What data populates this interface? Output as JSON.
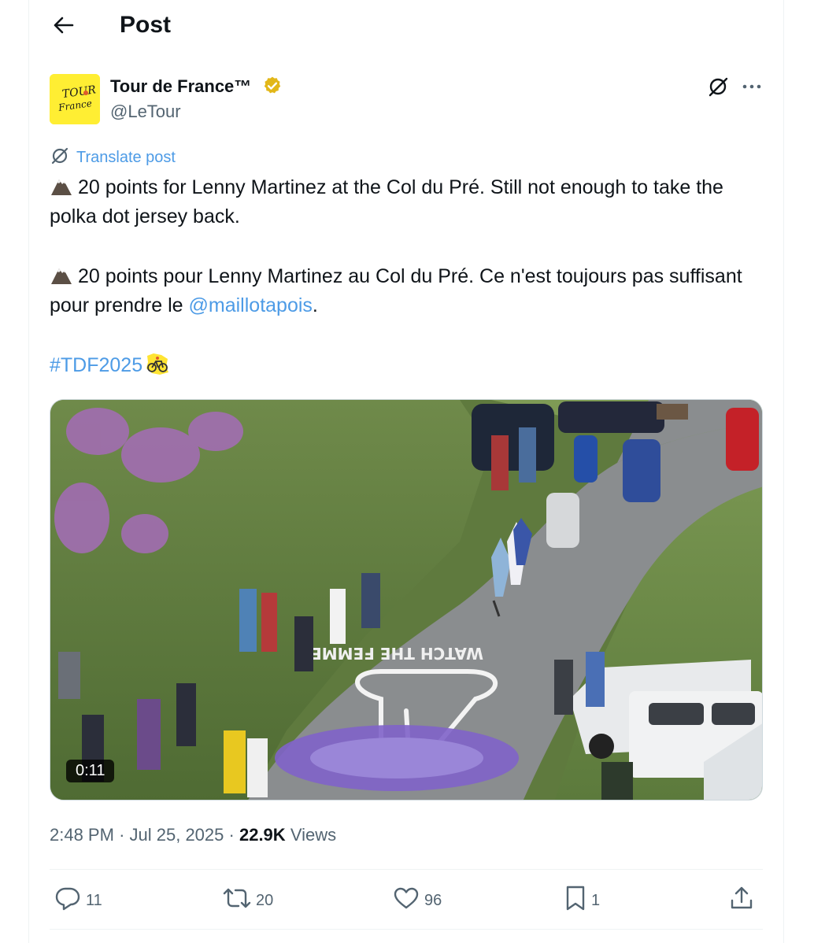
{
  "header": {
    "title": "Post"
  },
  "author": {
    "display_name": "Tour de France™",
    "handle": "@LeTour",
    "avatar_text_top": "TOUR",
    "avatar_text_bottom": "France",
    "avatar_bg": "#ffee33",
    "verified_color": "#e2b719"
  },
  "translate": {
    "label": "Translate post"
  },
  "post": {
    "line1": "20 points for Lenny Martinez at the Col du Pré. Still not enough to take the polka dot jersey back.",
    "line2_prefix": "20 points pour Lenny Martinez au Col du Pré. Ce n'est toujours pas suffisant pour prendre le ",
    "mention": "@maillotapois",
    "line2_suffix": ".",
    "hashtag": "#TDF2025"
  },
  "media": {
    "duration": "0:11",
    "road_text": "WATCH THE FEMMES"
  },
  "meta": {
    "time": "2:48 PM",
    "separator": "·",
    "date": "Jul 25, 2025",
    "views_count": "22.9K",
    "views_label": "Views"
  },
  "actions": {
    "replies": "11",
    "reposts": "20",
    "likes": "96",
    "bookmarks": "1"
  },
  "colors": {
    "link": "#4d9be6",
    "muted": "#536471",
    "text": "#0f1419"
  }
}
